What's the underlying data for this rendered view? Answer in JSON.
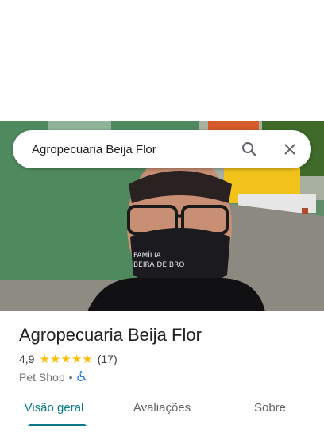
{
  "search": {
    "query": "Agropecuaria Beija Flor"
  },
  "icons": {
    "search": "search-icon",
    "close": "close-icon",
    "accessibility": "wheelchair-icon",
    "star": "star-icon"
  },
  "place": {
    "name": "Agropecuaria Beija Flor",
    "rating": "4,9",
    "stars": 5,
    "review_count": "(17)",
    "category": "Pet Shop",
    "separator": "•",
    "mask_text_line1": "FAMÍLIA",
    "mask_text_line2": "BEIRA DE BRO"
  },
  "tabs": [
    {
      "label": "Visão geral",
      "active": true
    },
    {
      "label": "Avaliações",
      "active": false
    },
    {
      "label": "Sobre",
      "active": false
    }
  ],
  "colors": {
    "accent": "#0b7a86",
    "star": "#fbbc04",
    "wheelchair": "#1a73e8"
  }
}
